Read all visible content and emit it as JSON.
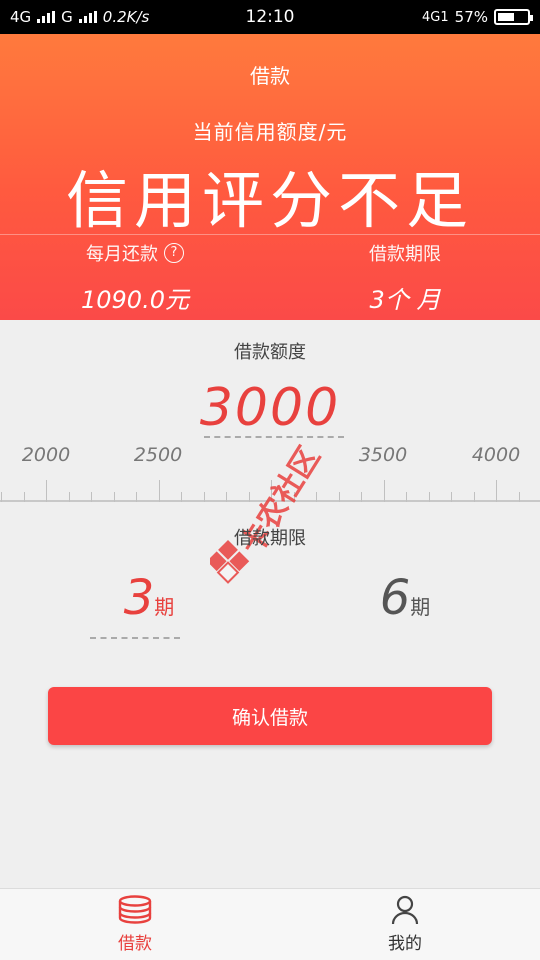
{
  "status_bar": {
    "network1": "4G",
    "network2": "G",
    "speed": "0.2K/s",
    "time": "12:10",
    "network3": "4G1",
    "battery_percent": "57%",
    "battery_level": 0.57
  },
  "header": {
    "title": "借款",
    "credit_caption": "当前信用额度/元",
    "credit_value": "信用评分不足",
    "monthly_payment_label": "每月还款",
    "help_symbol": "?",
    "monthly_payment_value": "1090.0元",
    "term_label": "借款期限",
    "term_value": "3个 月"
  },
  "amount": {
    "label": "借款额度",
    "value": "3000",
    "ruler_labels": [
      "2000",
      "2500",
      "3500",
      "4000"
    ]
  },
  "term": {
    "label": "借款期限",
    "options": [
      {
        "num": "3",
        "unit": "期",
        "selected": true
      },
      {
        "num": "6",
        "unit": "期",
        "selected": false
      }
    ]
  },
  "confirm_button": "确认借款",
  "bottom_nav": {
    "items": [
      {
        "label": "借款",
        "icon": "coins-stack-icon",
        "active": true
      },
      {
        "label": "我的",
        "icon": "user-icon",
        "active": false
      }
    ]
  },
  "watermark_text": "卡农社区",
  "colors": {
    "accent": "#e8413e",
    "button": "#fb4545",
    "header_top": "#ff7a3d",
    "header_bottom": "#fb4a48"
  }
}
